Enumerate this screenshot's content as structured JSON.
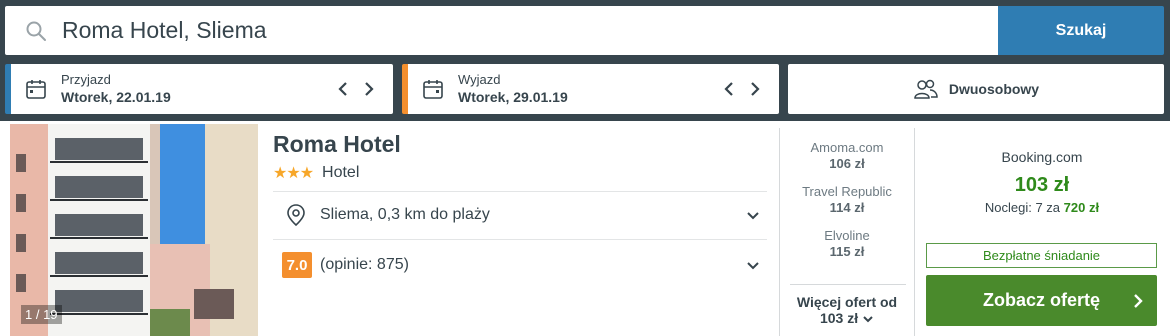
{
  "search": {
    "value": "Roma Hotel, Sliema",
    "button_label": "Szukaj"
  },
  "dates": {
    "checkin_label": "Przyjazd",
    "checkin_value": "Wtorek, 22.01.19",
    "checkout_label": "Wyjazd",
    "checkout_value": "Wtorek, 29.01.19"
  },
  "room": {
    "label": "Dwuosobowy"
  },
  "hotel": {
    "name": "Roma Hotel",
    "stars": "★★★",
    "type": "Hotel",
    "location": "Sliema, 0,3 km do plaży",
    "rating": "7.0",
    "reviews": "(opinie: 875)",
    "photo_counter": "1 / 19"
  },
  "offers": [
    {
      "provider": "Amoma.com",
      "price": "106 zł"
    },
    {
      "provider": "Travel Republic",
      "price": "114 zł"
    },
    {
      "provider": "Elvoline",
      "price": "115 zł"
    }
  ],
  "more_offers": {
    "line1": "Więcej ofert od",
    "line2": "103 zł"
  },
  "deal": {
    "provider": "Booking.com",
    "price": "103 zł",
    "nights_text": "Noclegi: 7 za",
    "nights_total": "720 zł",
    "breakfast": "Bezpłatne śniadanie",
    "cta": "Zobacz ofertę"
  },
  "colors": {
    "header_bg": "#37454d",
    "search_button": "#2f7db3",
    "checkout_accent": "#f48f2e",
    "price_green": "#2f8a1b",
    "cta_green": "#4a8a2c",
    "rating_orange": "#f48f2e",
    "star_color": "#f7a72a"
  },
  "icons": {
    "search": "search-icon",
    "calendar": "calendar-icon",
    "guests": "users-icon",
    "location": "map-pin-icon",
    "chevron": "chevron-down-icon"
  }
}
